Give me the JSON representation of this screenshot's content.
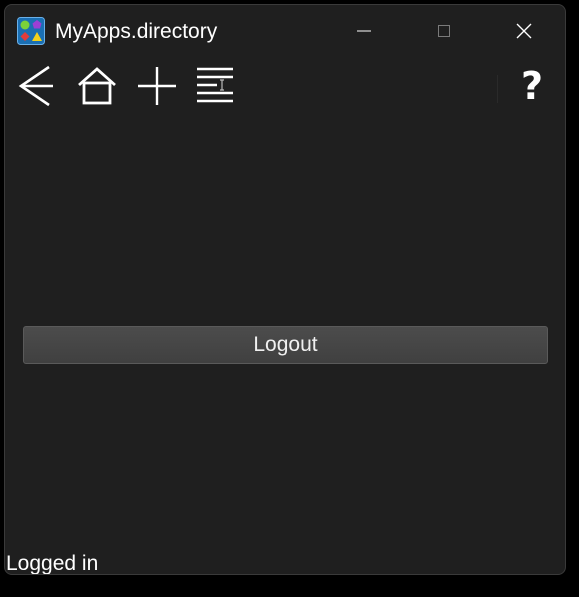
{
  "window": {
    "title": "MyApps.directory"
  },
  "toolbar": {
    "back_icon": "back-arrow-icon",
    "home_icon": "home-icon",
    "add_icon": "plus-icon",
    "list_icon": "list-menu-icon",
    "help_label": "?"
  },
  "main": {
    "logout_label": "Logout"
  },
  "status": {
    "text": "Logged in"
  },
  "colors": {
    "background": "#1f1f1f",
    "button": "#474747",
    "text": "#ffffff"
  }
}
